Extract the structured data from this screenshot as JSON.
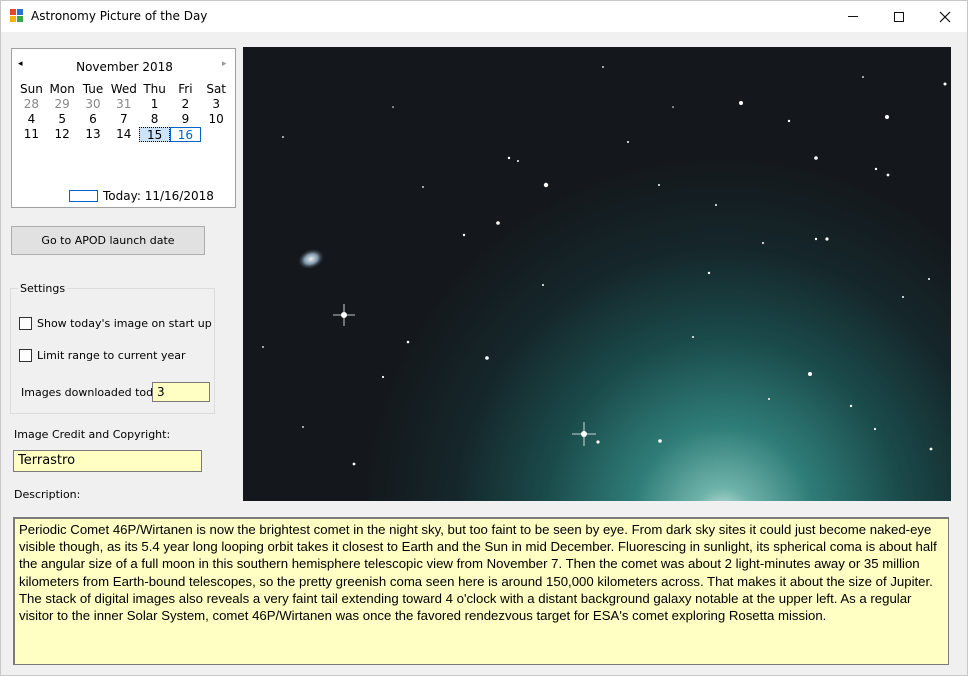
{
  "window": {
    "title": "Astronomy Picture of the Day",
    "controls": [
      "minimize-icon",
      "maximize-icon",
      "close-icon"
    ]
  },
  "calendar": {
    "month_label": "November 2018",
    "prev_icon": "◂",
    "next_icon": "▸",
    "weekdays": [
      "Sun",
      "Mon",
      "Tue",
      "Wed",
      "Thu",
      "Fri",
      "Sat"
    ],
    "weeks": [
      [
        "28",
        "29",
        "30",
        "31",
        "1",
        "2",
        "3"
      ],
      [
        "4",
        "5",
        "6",
        "7",
        "8",
        "9",
        "10"
      ],
      [
        "11",
        "12",
        "13",
        "14",
        "15",
        "16",
        ""
      ]
    ],
    "selected_day": "15",
    "today_day": "16",
    "today_label": "Today: 11/16/2018"
  },
  "launch_button": "Go to APOD launch date",
  "settings": {
    "group_label": "Settings",
    "show_on_startup_label": "Show today's image on start up",
    "show_on_startup_checked": false,
    "limit_range_label": "Limit range to current year",
    "limit_range_checked": false,
    "images_downloaded_label": "Images downloaded today",
    "images_downloaded_value": "3"
  },
  "credit": {
    "label": "Image Credit and Copyright:",
    "value": "Terrastro"
  },
  "description": {
    "label": "Description:",
    "text": "Periodic Comet 46P/Wirtanen is now the brightest comet in the night sky, but too faint to be seen by eye. From dark sky sites it could just become naked-eye visible though, as its 5.4 year long looping orbit takes it closest to Earth and the Sun in mid December. Fluorescing in sunlight, its spherical coma is about half the angular size of a full moon in this southern hemisphere telescopic view from November 7. Then the comet was about 2 light-minutes away or 35 million kilometers from Earth-bound telescopes, so the pretty greenish coma seen here is around 150,000 kilometers across. That makes it about the size of Jupiter. The stack of digital images also reveals a very faint tail extending toward 4 o'clock with a distant background galaxy notable at the upper left. As a regular visitor to the inner Solar System, comet 46P/Wirtanen was once the favored rendezvous target for ESA's comet exploring Rosetta mission."
  },
  "colors": {
    "input_background": "#ffffc4",
    "sky": "#14181c",
    "coma": "#3f8f8a"
  }
}
